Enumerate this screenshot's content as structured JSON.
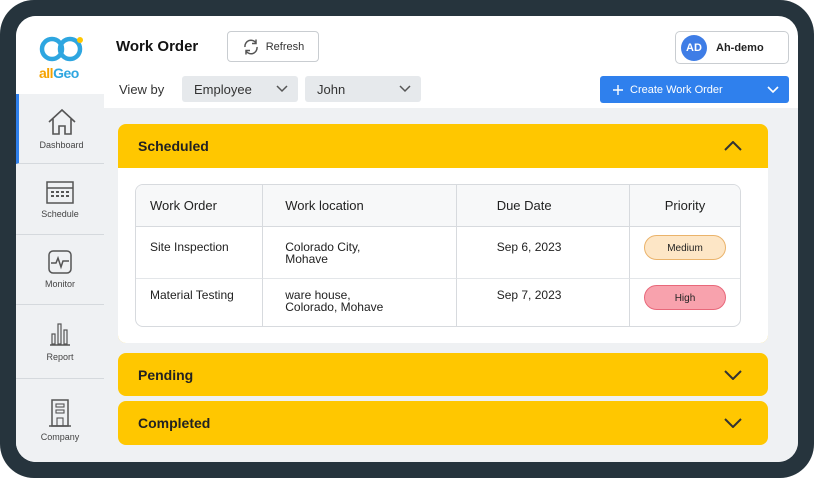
{
  "app": {
    "logo_text": "allGeo",
    "page_title": "Work Order"
  },
  "sidebar": {
    "items": [
      {
        "label": "Dashboard",
        "icon": "home-icon"
      },
      {
        "label": "Schedule",
        "icon": "calendar-icon"
      },
      {
        "label": "Monitor",
        "icon": "monitor-icon"
      },
      {
        "label": "Report",
        "icon": "bar-chart-icon"
      },
      {
        "label": "Company",
        "icon": "building-icon"
      }
    ]
  },
  "header": {
    "refresh_label": "Refresh",
    "user": {
      "initials": "AD",
      "name": "Ah-demo"
    },
    "view_by_label": "View by",
    "view_by_value": "Employee",
    "employee_value": "John",
    "create_label": "Create Work Order"
  },
  "sections": {
    "scheduled": "Scheduled",
    "pending": "Pending",
    "completed": "Completed"
  },
  "table": {
    "headers": [
      "Work Order",
      "Work location",
      "Due Date",
      "Priority"
    ],
    "rows": [
      {
        "work_order": "Site Inspection",
        "location_line1": "Colorado City,",
        "location_line2": "Mohave",
        "due": "Sep 6, 2023",
        "priority": "Medium"
      },
      {
        "work_order": "Material Testing",
        "location_line1": "ware house,",
        "location_line2": "Colorado, Mohave",
        "due": "Sep 7, 2023",
        "priority": "High"
      }
    ]
  },
  "colors": {
    "accent": "#2f80ed",
    "section": "#ffc700",
    "frame": "#26343d",
    "medium": "#fde6c6",
    "high": "#f8a2ad"
  }
}
